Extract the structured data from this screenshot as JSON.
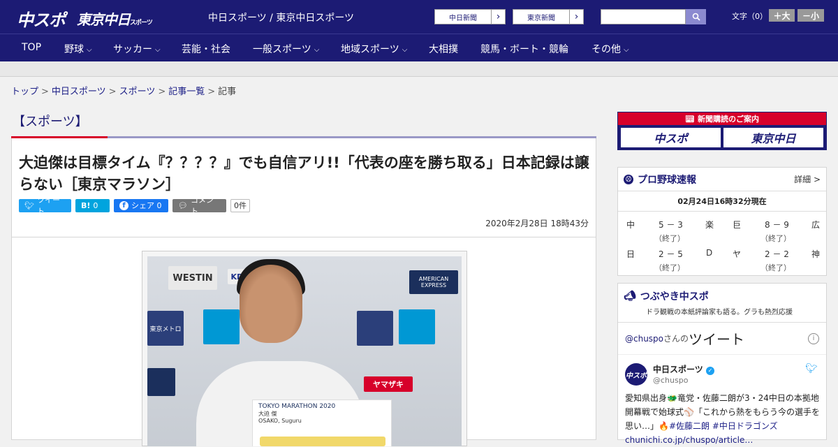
{
  "header": {
    "logo_chuspo": "中スポ",
    "logo_tokyo": "東京中日",
    "logo_tokyo_small": "スポーツ",
    "site_name": "中日スポーツ / 東京中日スポーツ",
    "paper_links": [
      {
        "label": "中日新聞"
      },
      {
        "label": "東京新聞"
      }
    ],
    "search_placeholder": "",
    "font_size_label": "文字（0）",
    "font_plus": "＋大",
    "font_minus": "－小",
    "colors": {
      "brand": "#1c1b74",
      "accent": "#d7002a"
    }
  },
  "nav": {
    "items": [
      {
        "label": "TOP",
        "has_menu": false
      },
      {
        "label": "野球",
        "has_menu": true
      },
      {
        "label": "サッカー",
        "has_menu": true
      },
      {
        "label": "芸能・社会",
        "has_menu": false
      },
      {
        "label": "一般スポーツ",
        "has_menu": true
      },
      {
        "label": "地域スポーツ",
        "has_menu": true
      },
      {
        "label": "大相撲",
        "has_menu": false
      },
      {
        "label": "競馬・ボート・競輪",
        "has_menu": false
      },
      {
        "label": "その他",
        "has_menu": true
      }
    ]
  },
  "breadcrumb": {
    "items": [
      "トップ",
      "中日スポーツ",
      "スポーツ",
      "記事一覧",
      "記事"
    ],
    "sep": ">"
  },
  "article": {
    "section": "【スポーツ】",
    "title": "大迫傑は目標タイム『？？？？』でも自信アリ!!「代表の座を勝ち取る」日本記録は譲らない［東京マラソン］",
    "share": {
      "tweet": "ツイート",
      "hatena_label": "B!",
      "hatena_count": "0",
      "facebook": "シェア 0",
      "comment": "コメント",
      "comment_count": "0件"
    },
    "date": "2020年2月28日 18時43分",
    "photo": {
      "placard_line1": "TOKYO MARATHON 2020",
      "placard_line2": "大迫 傑",
      "placard_line3": "OSAKO, Suguru",
      "sponsors": [
        "WESTIN",
        "KDDI",
        "東京メトロ",
        "ヤマザキ",
        "AMERICAN EXPRESS"
      ]
    }
  },
  "sidebar": {
    "subscribe_banner": "新聞購読のご案内",
    "subscribe_logos": [
      "中スポ",
      "東京中日"
    ],
    "baseball": {
      "title": "プロ野球速報",
      "more": "詳細 >",
      "time": "02月24日16時32分現在",
      "games": [
        {
          "home": "中",
          "score": "5 － 3",
          "away": "楽",
          "status": "（終了）"
        },
        {
          "home": "巨",
          "score": "8 － 9",
          "away": "広",
          "status": "（終了）"
        },
        {
          "home": "日",
          "score": "2 － 5",
          "away": "D",
          "status": "（終了）"
        },
        {
          "home": "ヤ",
          "score": "2 － 2",
          "away": "神",
          "status": "（終了）"
        }
      ]
    },
    "tweets": {
      "title": "つぶやき中スポ",
      "subtitle": "ドラ観戦の本紙評論家も語る。グラも熱烈応援",
      "handle": "@chuspo",
      "handle_suffix": "さんの",
      "word": "ツイート",
      "account_name": "中日スポーツ",
      "account_user": "@chuspo",
      "avatar_text": "中スポ",
      "text": "愛知県出身🐲竜党・佐藤二朗が3・24中日の本拠地開幕戦で始球式⚾「これから熱をもらう今の選手を思い…」🔥",
      "tags": "#佐藤二朗 #中日ドラゴンズ",
      "link": "chunichi.co.jp/chuspo/article…"
    }
  }
}
